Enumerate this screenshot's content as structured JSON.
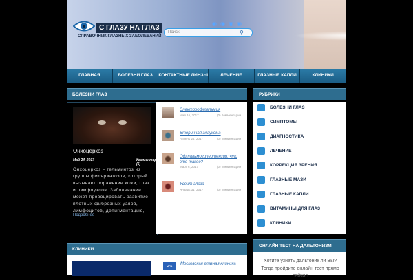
{
  "site": {
    "title": "С ГЛАЗУ НА ГЛАЗ",
    "subtitle": "СПРАВОЧНИК ГЛАЗНЫХ ЗАБОЛЕВАНИЙ"
  },
  "search": {
    "placeholder": "Поиск"
  },
  "nav": {
    "items": [
      "ГЛАВНАЯ",
      "БОЛЕЗНИ ГЛАЗ",
      "КОНТАКТНЫЕ ЛИНЗЫ",
      "ЛЕЧЕНИЕ",
      "ГЛАЗНЫЕ КАПЛИ",
      "КЛИНИКИ"
    ]
  },
  "diseases": {
    "heading": "БОЛЕЗНИ ГЛАЗ",
    "featured": {
      "title": "Онхоцеркоз",
      "date": "Май 24, 2017",
      "comments": "Комментарии (5)",
      "text": "Онхоцеркоз – гельминтоз из группы филяриатозов, который вызывает поражение кожи, глаз и лимфоузлов. Заболевание может провоцировать развитие плотных фиброзных узлов, лимфоцитов, депигментацию,",
      "more": "Подробнее"
    },
    "items": [
      {
        "title": "Электроофтальмия",
        "date": "Май 16, 2017",
        "comments": "(0) Комментарии"
      },
      {
        "title": "Вторичная глаукома",
        "date": "Апрель 24, 2017",
        "comments": "(0) Комментарии"
      },
      {
        "title": "Офтальмогипертензия: что это такое?",
        "date": "Март 6, 2017",
        "comments": "(0) Комментарии"
      },
      {
        "title": "Увеит глаза",
        "date": "Январь 31, 2017",
        "comments": "(0) Комментарии"
      }
    ]
  },
  "rubrics": {
    "heading": "РУБРИКИ",
    "items": [
      "БОЛЕЗНИ ГЛАЗ",
      "СИМПТОМЫ",
      "ДИАГНОСТИКА",
      "ЛЕЧЕНИЕ",
      "КОРРЕКЦИЯ ЗРЕНИЯ",
      "ГЛАЗНЫЕ МАЗИ",
      "ГЛАЗНЫЕ КАПЛИ",
      "ВИТАМИНЫ ДЛЯ ГЛАЗ",
      "КЛИНИКИ"
    ]
  },
  "clinics": {
    "heading": "КЛИНИКИ",
    "logo": "МГБ",
    "first_link": "Московская глазная клиника"
  },
  "test": {
    "heading": "ОНЛАЙН ТЕСТ НА ДАЛЬТОНИЗМ",
    "text": "Хотите узнать дальтоник ли Вы? Тогда пройдите онлайн тест прямо сейчас"
  }
}
